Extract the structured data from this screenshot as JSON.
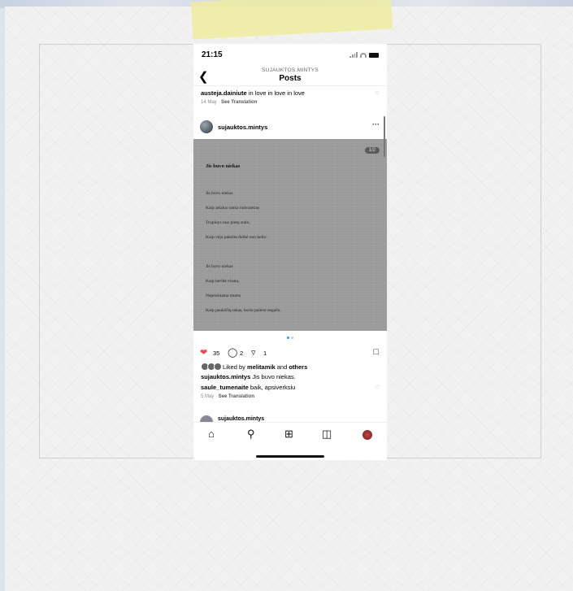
{
  "status_bar": {
    "time": "21:15"
  },
  "header": {
    "account": "SUJAUKTOS.MINTYS",
    "title": "Posts",
    "back_icon": "chevron-left-icon"
  },
  "top_comment": {
    "user": "austeja.dainiute",
    "text": " in love in love in love",
    "date": "14 May",
    "see_translation": "See Translation"
  },
  "post": {
    "user": "sujauktos.mintys",
    "menu": "···",
    "counter": "1/2",
    "poem_title": "Jis buvo niekas",
    "poem_lines": [
      "Jis buvo niekas",
      "Kaip atšalus ranka nubrauktas",
      "Trupinys nuo pietų stalo,",
      "Kaip vėjo pakelta dulkė nuo kelio.",
      "Jis buvo niekas",
      "Kaip beribė visata,",
      "Nepriеinama mums",
      "Kaip paukščių takas, kurio paliest negalis."
    ],
    "likes_count": "35",
    "comments_count": "2",
    "shares_count": "1",
    "liked_by_prefix": "Liked by ",
    "liked_by_user": "melitamik",
    "liked_by_and": " and ",
    "liked_by_others": "others",
    "caption_user": "sujauktos.mintys",
    "caption_text": " Jis buvo niekas."
  },
  "second_comment": {
    "user": "saule_tumenaite",
    "text": " baik, apsiverksiu",
    "date": "5 May",
    "see_translation": "See Translation"
  },
  "next_post": {
    "user": "sujauktos.mintys"
  },
  "colors": {
    "like_red": "#ed4956",
    "poem_bg": "#999999",
    "dot_active": "#3897f0"
  }
}
